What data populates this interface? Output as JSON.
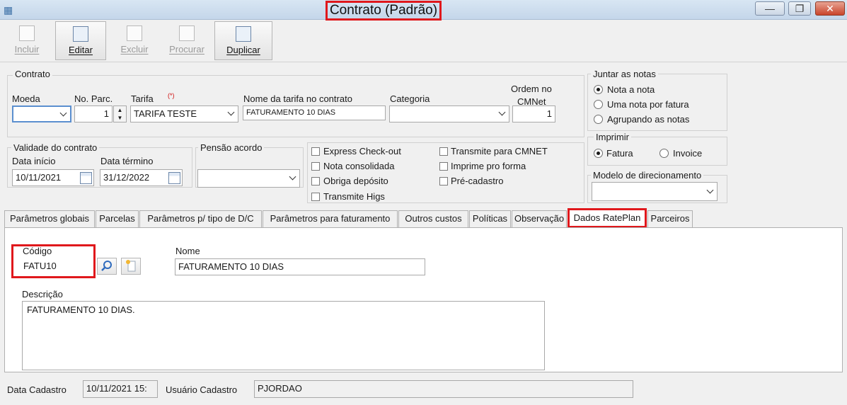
{
  "window": {
    "title": "Contrato (Padrão)",
    "minimize_glyph": "—",
    "restore_glyph": "❐",
    "close_glyph": "✕"
  },
  "toolbar": {
    "incluir": "Incluir",
    "editar": "Editar",
    "excluir": "Excluir",
    "procurar": "Procurar",
    "duplicar": "Duplicar"
  },
  "contrato": {
    "group_label": "Contrato",
    "moeda_label": "Moeda",
    "moeda_value": "",
    "parc_label": "No. Parc.",
    "parc_value": "1",
    "tarifa_label": "Tarifa",
    "tarifa_required": "(*)",
    "tarifa_value": "TARIFA TESTE",
    "nome_tarifa_label": "Nome da tarifa no contrato",
    "nome_tarifa_value": "FATURAMENTO 10 DIAS",
    "categoria_label": "Categoria",
    "categoria_value": "",
    "ordem_label_1": "Ordem no",
    "ordem_label_2": "CMNet",
    "ordem_value": "1"
  },
  "validade": {
    "group_label": "Validade do contrato",
    "inicio_label": "Data início",
    "inicio_value": "10/11/2021",
    "termino_label": "Data término",
    "termino_value": "31/12/2022"
  },
  "pensao": {
    "group_label": "Pensão acordo",
    "value": ""
  },
  "checkboxes": {
    "express": "Express Check-out",
    "consolidada": "Nota consolidada",
    "deposito": "Obriga depósito",
    "higs": "Transmite Higs",
    "cmnet": "Transmite para CMNET",
    "pro_forma": "Imprime pro forma",
    "pre_cadastro": "Pré-cadastro"
  },
  "juntar": {
    "group_label": "Juntar as notas",
    "opt1": "Nota a nota",
    "opt2": "Uma nota por fatura",
    "opt3": "Agrupando as notas",
    "selected": "Nota a nota"
  },
  "imprimir": {
    "group_label": "Imprimir",
    "opt1": "Fatura",
    "opt2": "Invoice",
    "selected": "Fatura"
  },
  "modelo": {
    "label": "Modelo de direcionamento",
    "value": ""
  },
  "tabs": [
    {
      "label": "Parâmetros globais"
    },
    {
      "label": "Parcelas"
    },
    {
      "label": "Parâmetros p/ tipo de D/C"
    },
    {
      "label": "Parâmetros para faturamento"
    },
    {
      "label": "Outros custos"
    },
    {
      "label": "Políticas"
    },
    {
      "label": "Observação"
    },
    {
      "label": "Dados RatePlan"
    },
    {
      "label": "Parceiros"
    }
  ],
  "rateplan": {
    "codigo_label": "Código",
    "codigo_value": "FATU10",
    "nome_label": "Nome",
    "nome_value": "FATURAMENTO 10 DIAS",
    "descricao_label": "Descrição",
    "descricao_value": "FATURAMENTO 10 DIAS."
  },
  "footer": {
    "data_cadastro_label": "Data Cadastro",
    "data_cadastro_value": "10/11/2021 15:",
    "usuario_label": "Usuário Cadastro",
    "usuario_value": "PJORDAO"
  },
  "colors": {
    "highlight": "#e0181c",
    "window_bg": "#f0f0f0"
  }
}
